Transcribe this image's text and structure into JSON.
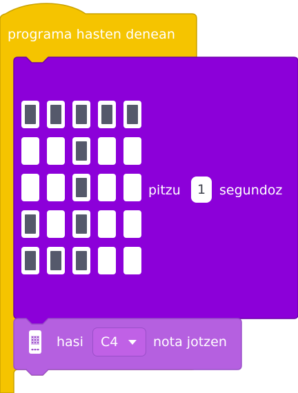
{
  "hat_block": {
    "label": "programa hasten denean",
    "color": "#f5c400",
    "border_color": "#c9a200"
  },
  "show_leds_block": {
    "color": "#8c00d9",
    "border_color": "#6e00aa",
    "pause_label": "pitzu",
    "duration_value": "1",
    "unit_label": "segundoz",
    "led_grid": [
      [
        1,
        1,
        1,
        1,
        1
      ],
      [
        0,
        0,
        1,
        0,
        0
      ],
      [
        0,
        0,
        1,
        0,
        0
      ],
      [
        1,
        0,
        1,
        0,
        0
      ],
      [
        1,
        1,
        1,
        0,
        0
      ]
    ]
  },
  "play_note_block": {
    "color": "#b560e0",
    "border_color": "#9a4fc9",
    "icon": "microbit-board-icon",
    "prefix_label": "hasi",
    "note_value": "C4",
    "suffix_label": "nota jotzen"
  }
}
